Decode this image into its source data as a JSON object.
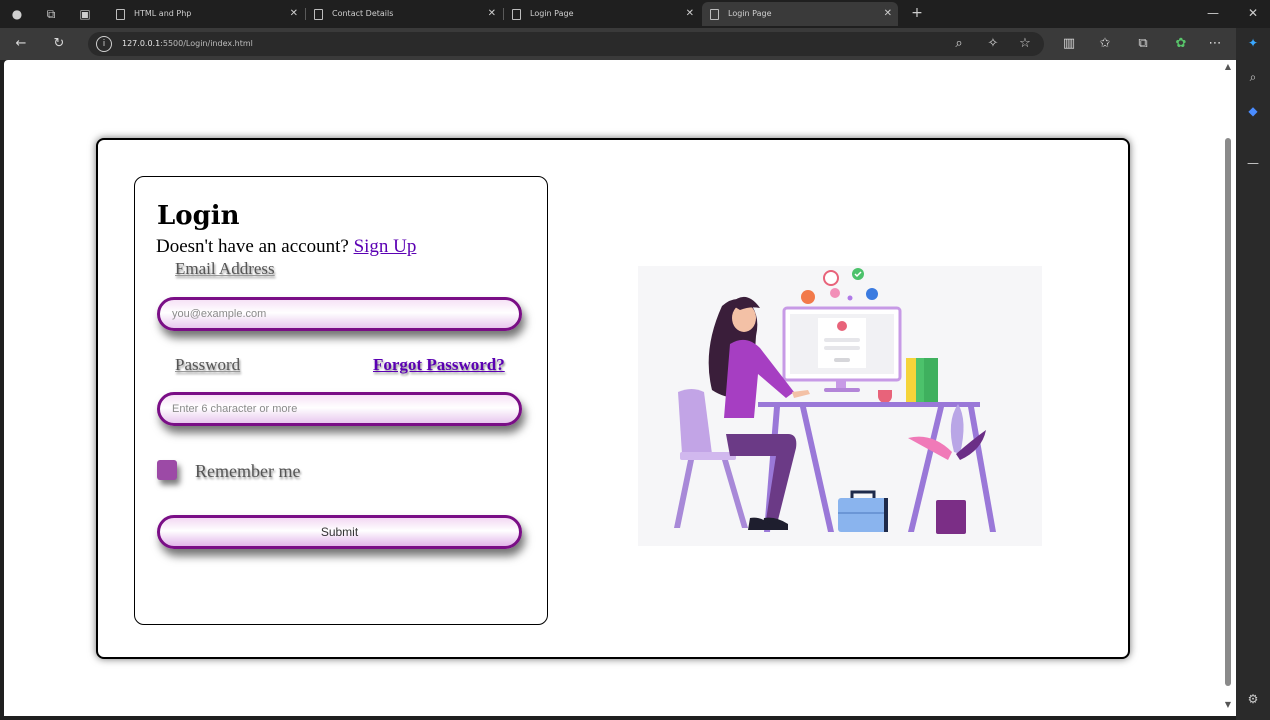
{
  "browser": {
    "tabs": [
      {
        "title": "HTML and Php",
        "active": false
      },
      {
        "title": "Contact Details",
        "active": false
      },
      {
        "title": "Login Page",
        "active": false
      },
      {
        "title": "Login Page",
        "active": true
      }
    ],
    "url_host": "127.0.0.1",
    "url_path": ":5500/Login/index.html"
  },
  "login": {
    "title": "Login",
    "signup_prompt": "Doesn't have an account?",
    "signup_link": "Sign Up",
    "email_label": "Email Address",
    "email_placeholder": "you@example.com",
    "password_label": "Password",
    "forgot_link": "Forgot Password?",
    "password_placeholder": "Enter 6 character or more",
    "remember_label": "Remember me",
    "submit_label": "Submit"
  },
  "colors": {
    "accent": "#7a0e86",
    "link": "#5b00b3",
    "checkbox": "#9c4aa6"
  }
}
